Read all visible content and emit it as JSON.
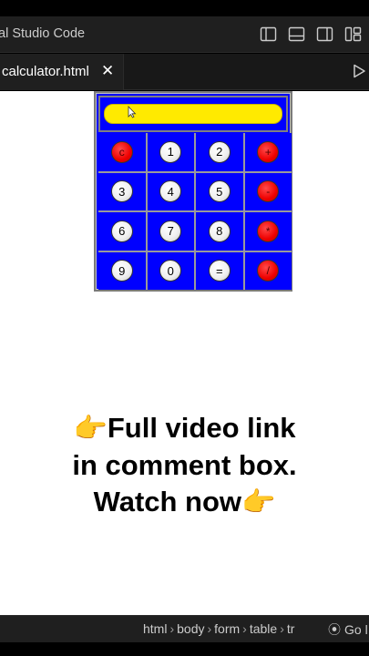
{
  "window": {
    "title": "al Studio Code"
  },
  "layout_icons": [
    "toggle-primary-sidebar-icon",
    "toggle-panel-icon",
    "toggle-secondary-sidebar-icon",
    "customize-layout-icon"
  ],
  "editor": {
    "tab": {
      "label": "calculator.html",
      "close": "✕"
    }
  },
  "calculator": {
    "display_value": "",
    "rows": [
      [
        {
          "label": "c",
          "kind": "op"
        },
        {
          "label": "1",
          "kind": "num"
        },
        {
          "label": "2",
          "kind": "num"
        },
        {
          "label": "+",
          "kind": "op"
        }
      ],
      [
        {
          "label": "3",
          "kind": "num"
        },
        {
          "label": "4",
          "kind": "num"
        },
        {
          "label": "5",
          "kind": "num"
        },
        {
          "label": "-",
          "kind": "op"
        }
      ],
      [
        {
          "label": "6",
          "kind": "num"
        },
        {
          "label": "7",
          "kind": "num"
        },
        {
          "label": "8",
          "kind": "num"
        },
        {
          "label": "*",
          "kind": "op"
        }
      ],
      [
        {
          "label": "9",
          "kind": "num"
        },
        {
          "label": "0",
          "kind": "num"
        },
        {
          "label": "=",
          "kind": "num"
        },
        {
          "label": "/",
          "kind": "op"
        }
      ]
    ],
    "colors": {
      "background": "#0000ff",
      "display": "#ffea00",
      "operator": "#ee0000",
      "number": "#f0f0f0"
    }
  },
  "caption": {
    "line1": "Full video link",
    "line2": "in comment box.",
    "line3": "Watch now",
    "emoji": "👉"
  },
  "statusbar": {
    "breadcrumbs": [
      "html",
      "body",
      "form",
      "table",
      "tr"
    ],
    "go_live": "Go l"
  }
}
